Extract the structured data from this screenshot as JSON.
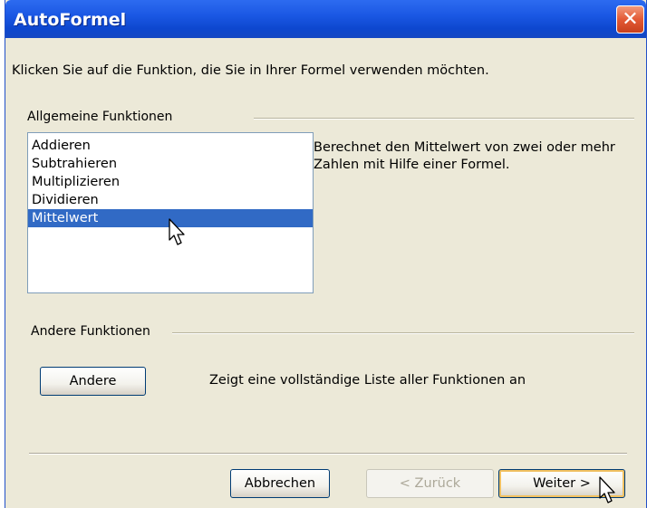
{
  "window": {
    "title": "AutoFormel",
    "close_glyph": "✕"
  },
  "intro_text": "Klicken Sie auf die Funktion, die Sie in Ihrer Formel verwenden möchten.",
  "general_group": {
    "label": "Allgemeine Funktionen",
    "items": [
      "Addieren",
      "Subtrahieren",
      "Multiplizieren",
      "Dividieren",
      "Mittelwert"
    ],
    "selected_item": "Mittelwert",
    "description": "Berechnet den Mittelwert von zwei oder mehr Zahlen mit Hilfe einer Formel."
  },
  "other_group": {
    "label": "Andere Funktionen",
    "button_label": "Andere",
    "description": "Zeigt eine vollständige Liste aller Funktionen an"
  },
  "footer": {
    "cancel_label": "Abbrechen",
    "back_label": "< Zurück",
    "next_label": "Weiter >"
  },
  "colors": {
    "titlebar": "#0d47cf",
    "selection": "#316ac5",
    "dialog_bg": "#ece9d8",
    "close_button": "#e35a35"
  },
  "icons": {
    "close": "close-icon",
    "cursor": "mouse-pointer-icon"
  }
}
